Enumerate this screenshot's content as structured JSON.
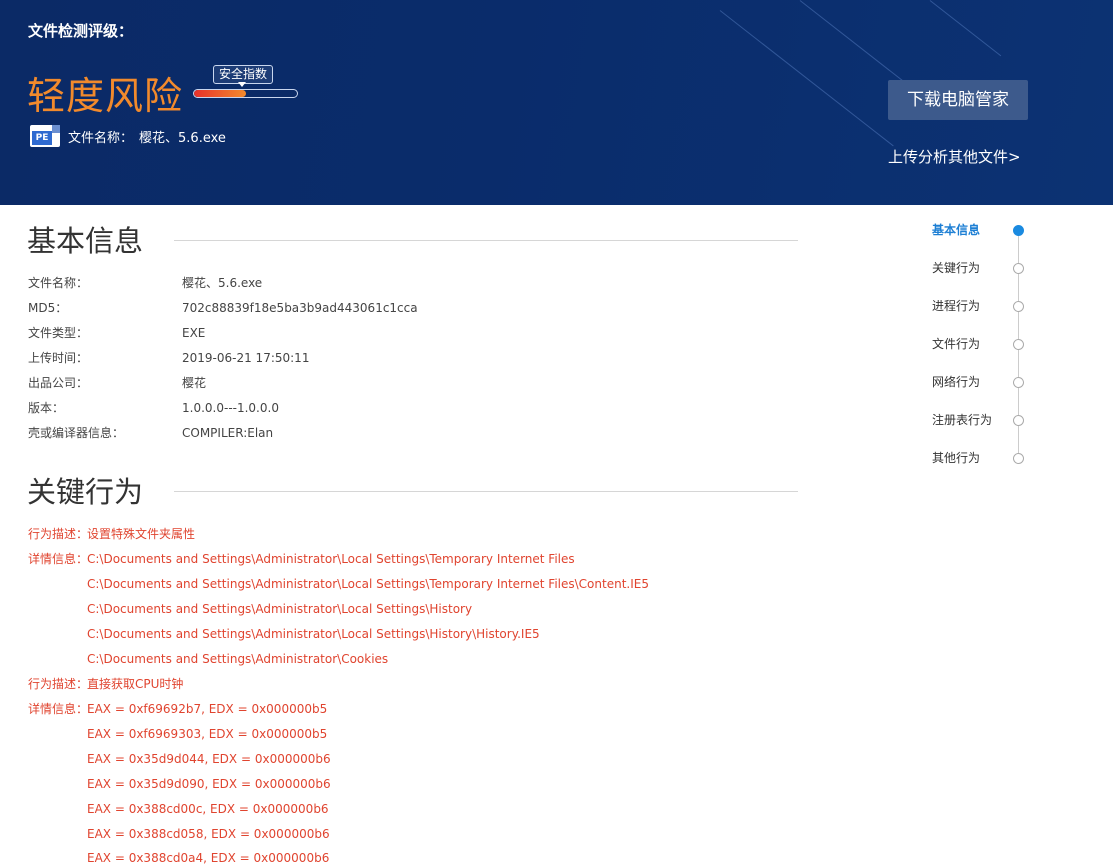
{
  "header": {
    "rating_label": "文件检测评级：",
    "risk_level": "轻度风险",
    "safety_index_label": "安全指数",
    "safety_index_level": 0.5,
    "file_icon": "pe-file-icon",
    "file_icon_text": "PE",
    "file_name_label": "文件名称：",
    "file_name_value": "樱花、5.6.exe",
    "download_button": "下载电脑管家",
    "upload_link": "上传分析其他文件>",
    "risk_color": "#f28a2c"
  },
  "basic_info": {
    "title": "基本信息",
    "rows": [
      {
        "key": "文件名称：",
        "value": "樱花、5.6.exe"
      },
      {
        "key": "MD5：",
        "value": "702c88839f18e5ba3b9ad443061c1cca"
      },
      {
        "key": "文件类型：",
        "value": "EXE"
      },
      {
        "key": "上传时间：",
        "value": "2019-06-21 17:50:11"
      },
      {
        "key": "出品公司：",
        "value": "樱花"
      },
      {
        "key": "版本：",
        "value": "1.0.0.0---1.0.0.0"
      },
      {
        "key": "壳或编译器信息：",
        "value": "COMPILER:Elan"
      }
    ]
  },
  "key_behavior": {
    "title": "关键行为",
    "rows": [
      {
        "key": "行为描述：",
        "value": "设置特殊文件夹属性"
      },
      {
        "key": "详情信息：",
        "value": "C:\\Documents and Settings\\Administrator\\Local Settings\\Temporary Internet Files"
      },
      {
        "key": "",
        "value": "C:\\Documents and Settings\\Administrator\\Local Settings\\Temporary Internet Files\\Content.IE5"
      },
      {
        "key": "",
        "value": "C:\\Documents and Settings\\Administrator\\Local Settings\\History"
      },
      {
        "key": "",
        "value": "C:\\Documents and Settings\\Administrator\\Local Settings\\History\\History.IE5"
      },
      {
        "key": "",
        "value": "C:\\Documents and Settings\\Administrator\\Cookies"
      },
      {
        "key": "行为描述：",
        "value": "直接获取CPU时钟"
      },
      {
        "key": "详情信息：",
        "value": "EAX = 0xf69692b7, EDX = 0x000000b5"
      },
      {
        "key": "",
        "value": "EAX = 0xf6969303, EDX = 0x000000b5"
      },
      {
        "key": "",
        "value": "EAX = 0x35d9d044, EDX = 0x000000b6"
      },
      {
        "key": "",
        "value": "EAX = 0x35d9d090, EDX = 0x000000b6"
      },
      {
        "key": "",
        "value": "EAX = 0x388cd00c, EDX = 0x000000b6"
      },
      {
        "key": "",
        "value": "EAX = 0x388cd058, EDX = 0x000000b6"
      },
      {
        "key": "",
        "value": "EAX = 0x388cd0a4, EDX = 0x000000b6"
      }
    ],
    "text_color": "#e0442f"
  },
  "side_nav": {
    "items": [
      {
        "label": "基本信息",
        "active": true
      },
      {
        "label": "关键行为",
        "active": false
      },
      {
        "label": "进程行为",
        "active": false
      },
      {
        "label": "文件行为",
        "active": false
      },
      {
        "label": "网络行为",
        "active": false
      },
      {
        "label": "注册表行为",
        "active": false
      },
      {
        "label": "其他行为",
        "active": false
      }
    ],
    "active_color": "#1d7fd4"
  }
}
